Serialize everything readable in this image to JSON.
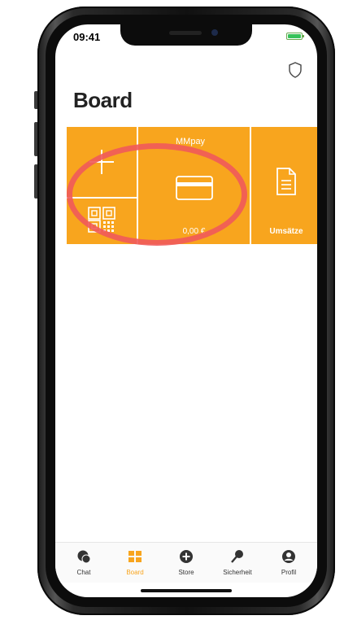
{
  "status_bar": {
    "time": "09:41"
  },
  "page": {
    "title": "Board"
  },
  "tiles": {
    "add": {
      "icon": "plus-icon"
    },
    "pay": {
      "label": "MMpay",
      "amount": "0,00 €",
      "icon": "credit-card-icon"
    },
    "transactions": {
      "label": "Umsätze",
      "icon": "document-icon"
    },
    "qr": {
      "icon": "qr-code-icon"
    }
  },
  "tabbar": {
    "items": [
      {
        "label": "Chat",
        "icon": "chat-icon"
      },
      {
        "label": "Board",
        "icon": "board-icon",
        "active": true
      },
      {
        "label": "Store",
        "icon": "store-plus-icon"
      },
      {
        "label": "Sicherheit",
        "icon": "key-icon"
      },
      {
        "label": "Profil",
        "icon": "profile-icon"
      }
    ]
  },
  "colors": {
    "accent": "#f8a51e",
    "annotation": "#f05a5a",
    "battery": "#36c25a"
  }
}
